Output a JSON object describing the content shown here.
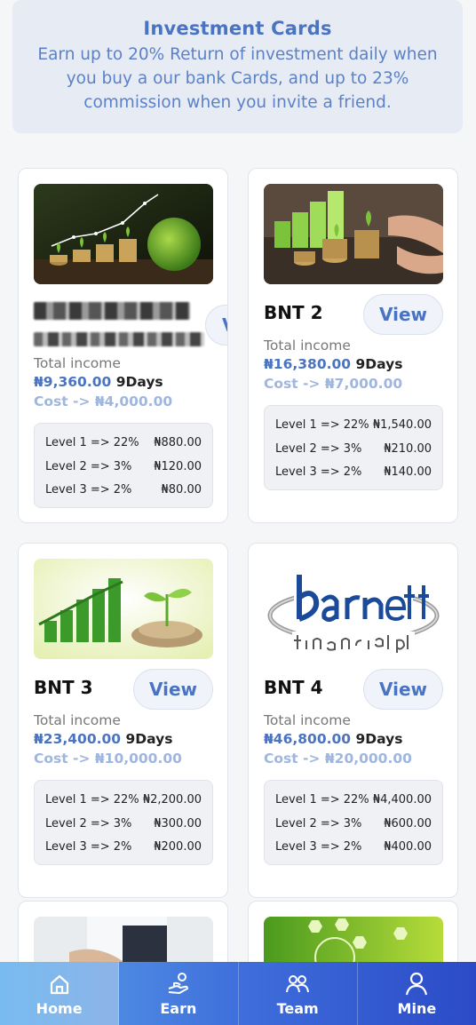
{
  "banner": {
    "title": "Investment Cards",
    "subtitle": "Earn up to 20% Return of investment daily when you buy a our bank Cards, and up to 23% commission when you invite a friend."
  },
  "cards": [
    {
      "name": "",
      "view_label": "View",
      "total_income_label": "Total income",
      "income": "₦9,360.00",
      "days": "9Days",
      "cost": "Cost -> ₦4,000.00",
      "levels": [
        {
          "label": "Level 1 => 22%",
          "value": "₦880.00"
        },
        {
          "label": "Level 2 => 3%",
          "value": "₦120.00"
        },
        {
          "label": "Level 3 => 2%",
          "value": "₦80.00"
        }
      ]
    },
    {
      "name": "BNT 2",
      "view_label": "View",
      "total_income_label": "Total income",
      "income": "₦16,380.00",
      "days": "9Days",
      "cost": "Cost -> ₦7,000.00",
      "levels": [
        {
          "label": "Level 1 => 22%",
          "value": "₦1,540.00"
        },
        {
          "label": "Level 2 => 3%",
          "value": "₦210.00"
        },
        {
          "label": "Level 3 => 2%",
          "value": "₦140.00"
        }
      ]
    },
    {
      "name": "BNT 3",
      "view_label": "View",
      "total_income_label": "Total income",
      "income": "₦23,400.00",
      "days": "9Days",
      "cost": "Cost -> ₦10,000.00",
      "levels": [
        {
          "label": "Level 1 => 22%",
          "value": "₦2,200.00"
        },
        {
          "label": "Level 2 => 3%",
          "value": "₦300.00"
        },
        {
          "label": "Level 3 => 2%",
          "value": "₦200.00"
        }
      ]
    },
    {
      "name": "BNT 4",
      "view_label": "View",
      "total_income_label": "Total income",
      "income": "₦46,800.00",
      "days": "9Days",
      "cost": "Cost -> ₦20,000.00",
      "levels": [
        {
          "label": "Level 1 => 22%",
          "value": "₦4,400.00"
        },
        {
          "label": "Level 2 => 3%",
          "value": "₦600.00"
        },
        {
          "label": "Level 3 => 2%",
          "value": "₦400.00"
        }
      ]
    }
  ],
  "nav": [
    {
      "label": "Home",
      "icon": "home-icon"
    },
    {
      "label": "Earn",
      "icon": "hand-coin-icon"
    },
    {
      "label": "Team",
      "icon": "team-icon"
    },
    {
      "label": "Mine",
      "icon": "user-icon"
    }
  ],
  "colors": {
    "accent": "#4a74c2",
    "cost": "#9fb6de",
    "nav_start": "#5aa2e8",
    "nav_end": "#2b4ac7"
  }
}
